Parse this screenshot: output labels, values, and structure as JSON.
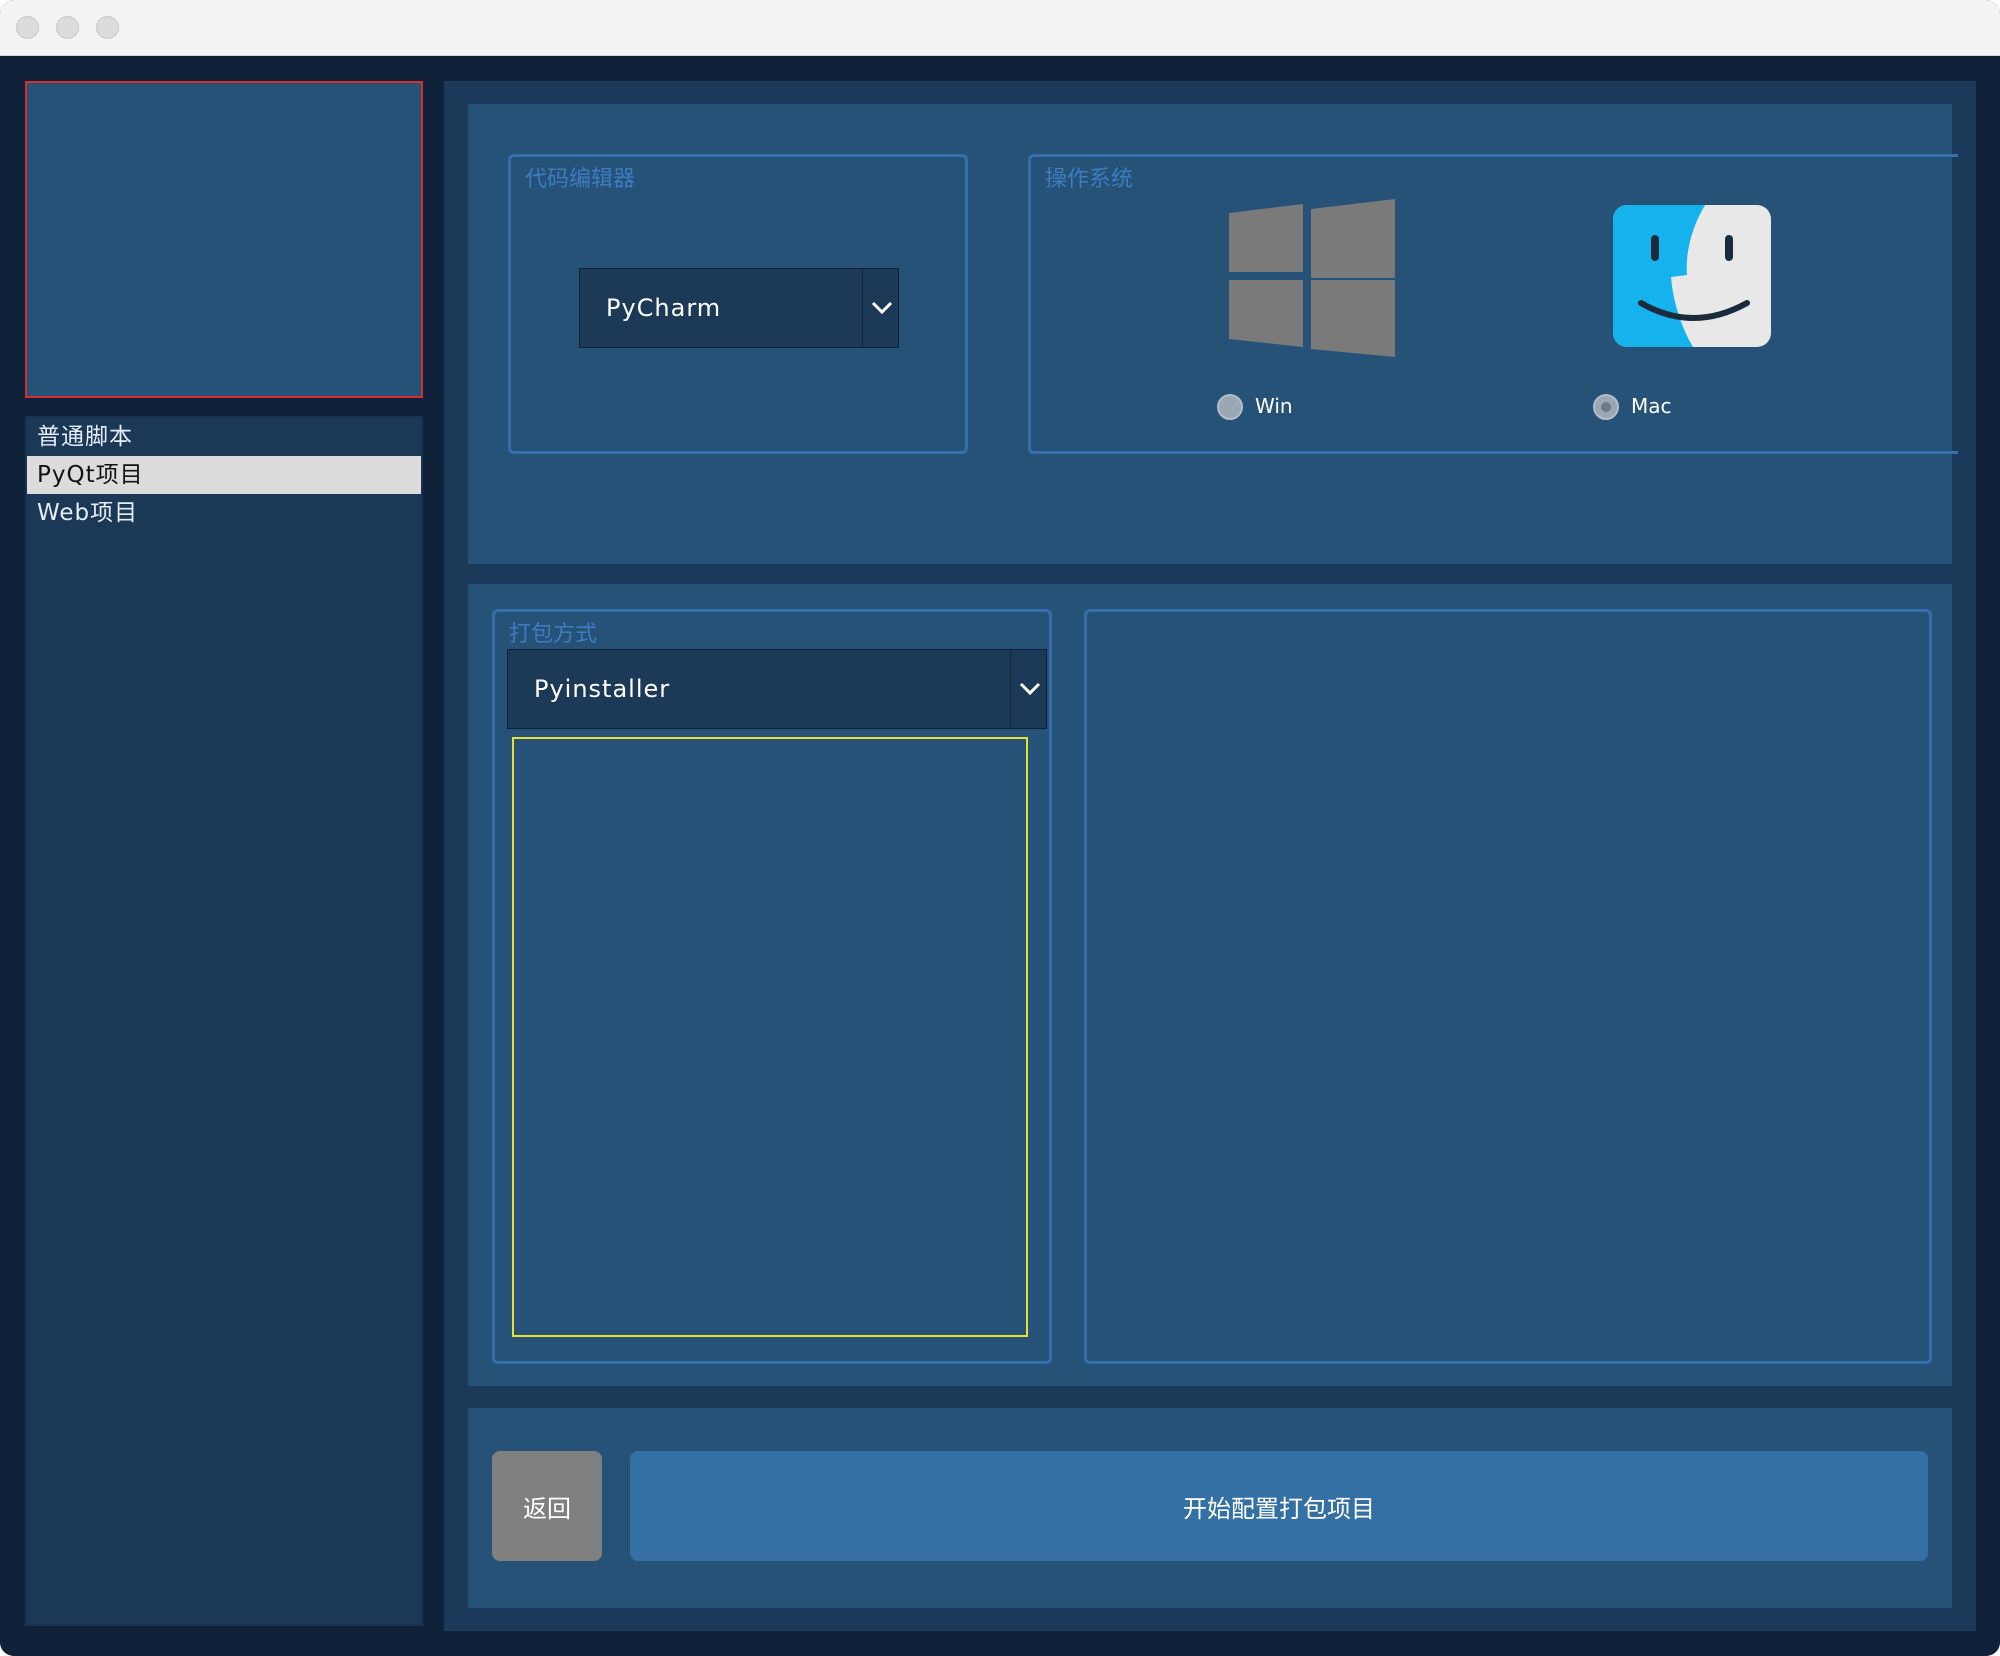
{
  "sidebar": {
    "items": [
      {
        "label": "普通脚本"
      },
      {
        "label": "PyQt项目"
      },
      {
        "label": "Web项目"
      }
    ],
    "selected_index": 1
  },
  "editor_group": {
    "title": "代码编辑器",
    "selected": "PyCharm"
  },
  "os_group": {
    "title": "操作系统",
    "options": [
      {
        "label": "Win",
        "icon": "windows-logo-icon",
        "checked": false
      },
      {
        "label": "Mac",
        "icon": "mac-finder-icon",
        "checked": true
      }
    ]
  },
  "pack_group": {
    "title": "打包方式",
    "selected": "Pyinstaller"
  },
  "actions": {
    "back_label": "返回",
    "start_label": "开始配置打包项目"
  },
  "colors": {
    "background": "#0f2239",
    "panel": "#265278",
    "group_border": "#3570ad",
    "primary_button": "#3570a4",
    "back_button": "#808080",
    "avatar_border": "#d62d2d",
    "options_border": "#e8e030"
  }
}
